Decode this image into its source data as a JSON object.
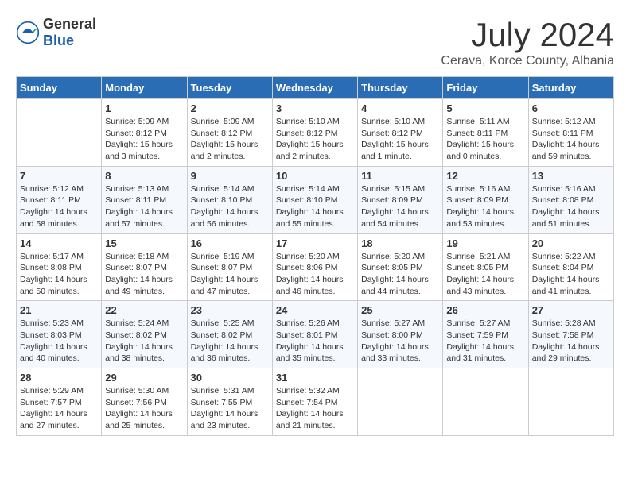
{
  "header": {
    "logo_general": "General",
    "logo_blue": "Blue",
    "title": "July 2024",
    "subtitle": "Cerava, Korce County, Albania"
  },
  "calendar": {
    "weekdays": [
      "Sunday",
      "Monday",
      "Tuesday",
      "Wednesday",
      "Thursday",
      "Friday",
      "Saturday"
    ],
    "weeks": [
      [
        {
          "day": "",
          "sunrise": "",
          "sunset": "",
          "daylight": ""
        },
        {
          "day": "1",
          "sunrise": "Sunrise: 5:09 AM",
          "sunset": "Sunset: 8:12 PM",
          "daylight": "Daylight: 15 hours and 3 minutes."
        },
        {
          "day": "2",
          "sunrise": "Sunrise: 5:09 AM",
          "sunset": "Sunset: 8:12 PM",
          "daylight": "Daylight: 15 hours and 2 minutes."
        },
        {
          "day": "3",
          "sunrise": "Sunrise: 5:10 AM",
          "sunset": "Sunset: 8:12 PM",
          "daylight": "Daylight: 15 hours and 2 minutes."
        },
        {
          "day": "4",
          "sunrise": "Sunrise: 5:10 AM",
          "sunset": "Sunset: 8:12 PM",
          "daylight": "Daylight: 15 hours and 1 minute."
        },
        {
          "day": "5",
          "sunrise": "Sunrise: 5:11 AM",
          "sunset": "Sunset: 8:11 PM",
          "daylight": "Daylight: 15 hours and 0 minutes."
        },
        {
          "day": "6",
          "sunrise": "Sunrise: 5:12 AM",
          "sunset": "Sunset: 8:11 PM",
          "daylight": "Daylight: 14 hours and 59 minutes."
        }
      ],
      [
        {
          "day": "7",
          "sunrise": "Sunrise: 5:12 AM",
          "sunset": "Sunset: 8:11 PM",
          "daylight": "Daylight: 14 hours and 58 minutes."
        },
        {
          "day": "8",
          "sunrise": "Sunrise: 5:13 AM",
          "sunset": "Sunset: 8:11 PM",
          "daylight": "Daylight: 14 hours and 57 minutes."
        },
        {
          "day": "9",
          "sunrise": "Sunrise: 5:14 AM",
          "sunset": "Sunset: 8:10 PM",
          "daylight": "Daylight: 14 hours and 56 minutes."
        },
        {
          "day": "10",
          "sunrise": "Sunrise: 5:14 AM",
          "sunset": "Sunset: 8:10 PM",
          "daylight": "Daylight: 14 hours and 55 minutes."
        },
        {
          "day": "11",
          "sunrise": "Sunrise: 5:15 AM",
          "sunset": "Sunset: 8:09 PM",
          "daylight": "Daylight: 14 hours and 54 minutes."
        },
        {
          "day": "12",
          "sunrise": "Sunrise: 5:16 AM",
          "sunset": "Sunset: 8:09 PM",
          "daylight": "Daylight: 14 hours and 53 minutes."
        },
        {
          "day": "13",
          "sunrise": "Sunrise: 5:16 AM",
          "sunset": "Sunset: 8:08 PM",
          "daylight": "Daylight: 14 hours and 51 minutes."
        }
      ],
      [
        {
          "day": "14",
          "sunrise": "Sunrise: 5:17 AM",
          "sunset": "Sunset: 8:08 PM",
          "daylight": "Daylight: 14 hours and 50 minutes."
        },
        {
          "day": "15",
          "sunrise": "Sunrise: 5:18 AM",
          "sunset": "Sunset: 8:07 PM",
          "daylight": "Daylight: 14 hours and 49 minutes."
        },
        {
          "day": "16",
          "sunrise": "Sunrise: 5:19 AM",
          "sunset": "Sunset: 8:07 PM",
          "daylight": "Daylight: 14 hours and 47 minutes."
        },
        {
          "day": "17",
          "sunrise": "Sunrise: 5:20 AM",
          "sunset": "Sunset: 8:06 PM",
          "daylight": "Daylight: 14 hours and 46 minutes."
        },
        {
          "day": "18",
          "sunrise": "Sunrise: 5:20 AM",
          "sunset": "Sunset: 8:05 PM",
          "daylight": "Daylight: 14 hours and 44 minutes."
        },
        {
          "day": "19",
          "sunrise": "Sunrise: 5:21 AM",
          "sunset": "Sunset: 8:05 PM",
          "daylight": "Daylight: 14 hours and 43 minutes."
        },
        {
          "day": "20",
          "sunrise": "Sunrise: 5:22 AM",
          "sunset": "Sunset: 8:04 PM",
          "daylight": "Daylight: 14 hours and 41 minutes."
        }
      ],
      [
        {
          "day": "21",
          "sunrise": "Sunrise: 5:23 AM",
          "sunset": "Sunset: 8:03 PM",
          "daylight": "Daylight: 14 hours and 40 minutes."
        },
        {
          "day": "22",
          "sunrise": "Sunrise: 5:24 AM",
          "sunset": "Sunset: 8:02 PM",
          "daylight": "Daylight: 14 hours and 38 minutes."
        },
        {
          "day": "23",
          "sunrise": "Sunrise: 5:25 AM",
          "sunset": "Sunset: 8:02 PM",
          "daylight": "Daylight: 14 hours and 36 minutes."
        },
        {
          "day": "24",
          "sunrise": "Sunrise: 5:26 AM",
          "sunset": "Sunset: 8:01 PM",
          "daylight": "Daylight: 14 hours and 35 minutes."
        },
        {
          "day": "25",
          "sunrise": "Sunrise: 5:27 AM",
          "sunset": "Sunset: 8:00 PM",
          "daylight": "Daylight: 14 hours and 33 minutes."
        },
        {
          "day": "26",
          "sunrise": "Sunrise: 5:27 AM",
          "sunset": "Sunset: 7:59 PM",
          "daylight": "Daylight: 14 hours and 31 minutes."
        },
        {
          "day": "27",
          "sunrise": "Sunrise: 5:28 AM",
          "sunset": "Sunset: 7:58 PM",
          "daylight": "Daylight: 14 hours and 29 minutes."
        }
      ],
      [
        {
          "day": "28",
          "sunrise": "Sunrise: 5:29 AM",
          "sunset": "Sunset: 7:57 PM",
          "daylight": "Daylight: 14 hours and 27 minutes."
        },
        {
          "day": "29",
          "sunrise": "Sunrise: 5:30 AM",
          "sunset": "Sunset: 7:56 PM",
          "daylight": "Daylight: 14 hours and 25 minutes."
        },
        {
          "day": "30",
          "sunrise": "Sunrise: 5:31 AM",
          "sunset": "Sunset: 7:55 PM",
          "daylight": "Daylight: 14 hours and 23 minutes."
        },
        {
          "day": "31",
          "sunrise": "Sunrise: 5:32 AM",
          "sunset": "Sunset: 7:54 PM",
          "daylight": "Daylight: 14 hours and 21 minutes."
        },
        {
          "day": "",
          "sunrise": "",
          "sunset": "",
          "daylight": ""
        },
        {
          "day": "",
          "sunrise": "",
          "sunset": "",
          "daylight": ""
        },
        {
          "day": "",
          "sunrise": "",
          "sunset": "",
          "daylight": ""
        }
      ]
    ]
  }
}
